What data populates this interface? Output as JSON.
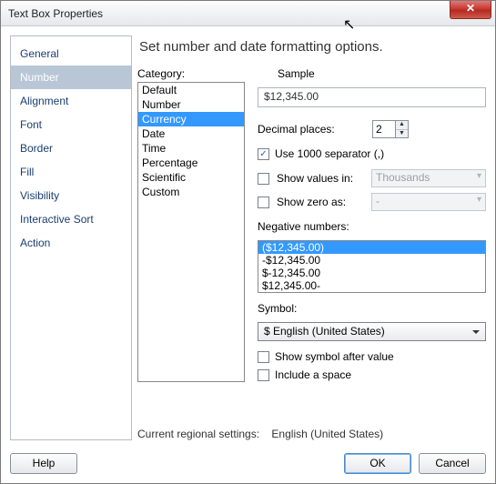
{
  "window": {
    "title": "Text Box Properties"
  },
  "nav": {
    "items": [
      {
        "label": "General"
      },
      {
        "label": "Number"
      },
      {
        "label": "Alignment"
      },
      {
        "label": "Font"
      },
      {
        "label": "Border"
      },
      {
        "label": "Fill"
      },
      {
        "label": "Visibility"
      },
      {
        "label": "Interactive Sort"
      },
      {
        "label": "Action"
      }
    ],
    "selected_index": 1
  },
  "panel": {
    "heading": "Set number and date formatting options.",
    "category_label": "Category:",
    "categories": [
      "Default",
      "Number",
      "Currency",
      "Date",
      "Time",
      "Percentage",
      "Scientific",
      "Custom"
    ],
    "category_selected_index": 2,
    "sample_label": "Sample",
    "sample_value": "$12,345.00",
    "decimal_label": "Decimal places:",
    "decimal_value": "2",
    "use1000_label": "Use 1000 separator (,)",
    "use1000_checked": true,
    "showvalues_label": "Show values in:",
    "showvalues_value": "Thousands",
    "showvalues_checked": false,
    "showzero_label": "Show zero as:",
    "showzero_value": "-",
    "showzero_checked": false,
    "negative_label": "Negative numbers:",
    "negative_options": [
      "($12,345.00)",
      "-$12,345.00",
      "$-12,345.00",
      "$12,345.00-"
    ],
    "negative_selected_index": 0,
    "symbol_label": "Symbol:",
    "symbol_value": "$ English (United States)",
    "showsymbolafter_label": "Show symbol after value",
    "showsymbolafter_checked": false,
    "includespace_label": "Include a space",
    "includespace_checked": false,
    "regional_label": "Current regional settings:",
    "regional_value": "English (United States)"
  },
  "footer": {
    "help": "Help",
    "ok": "OK",
    "cancel": "Cancel"
  }
}
